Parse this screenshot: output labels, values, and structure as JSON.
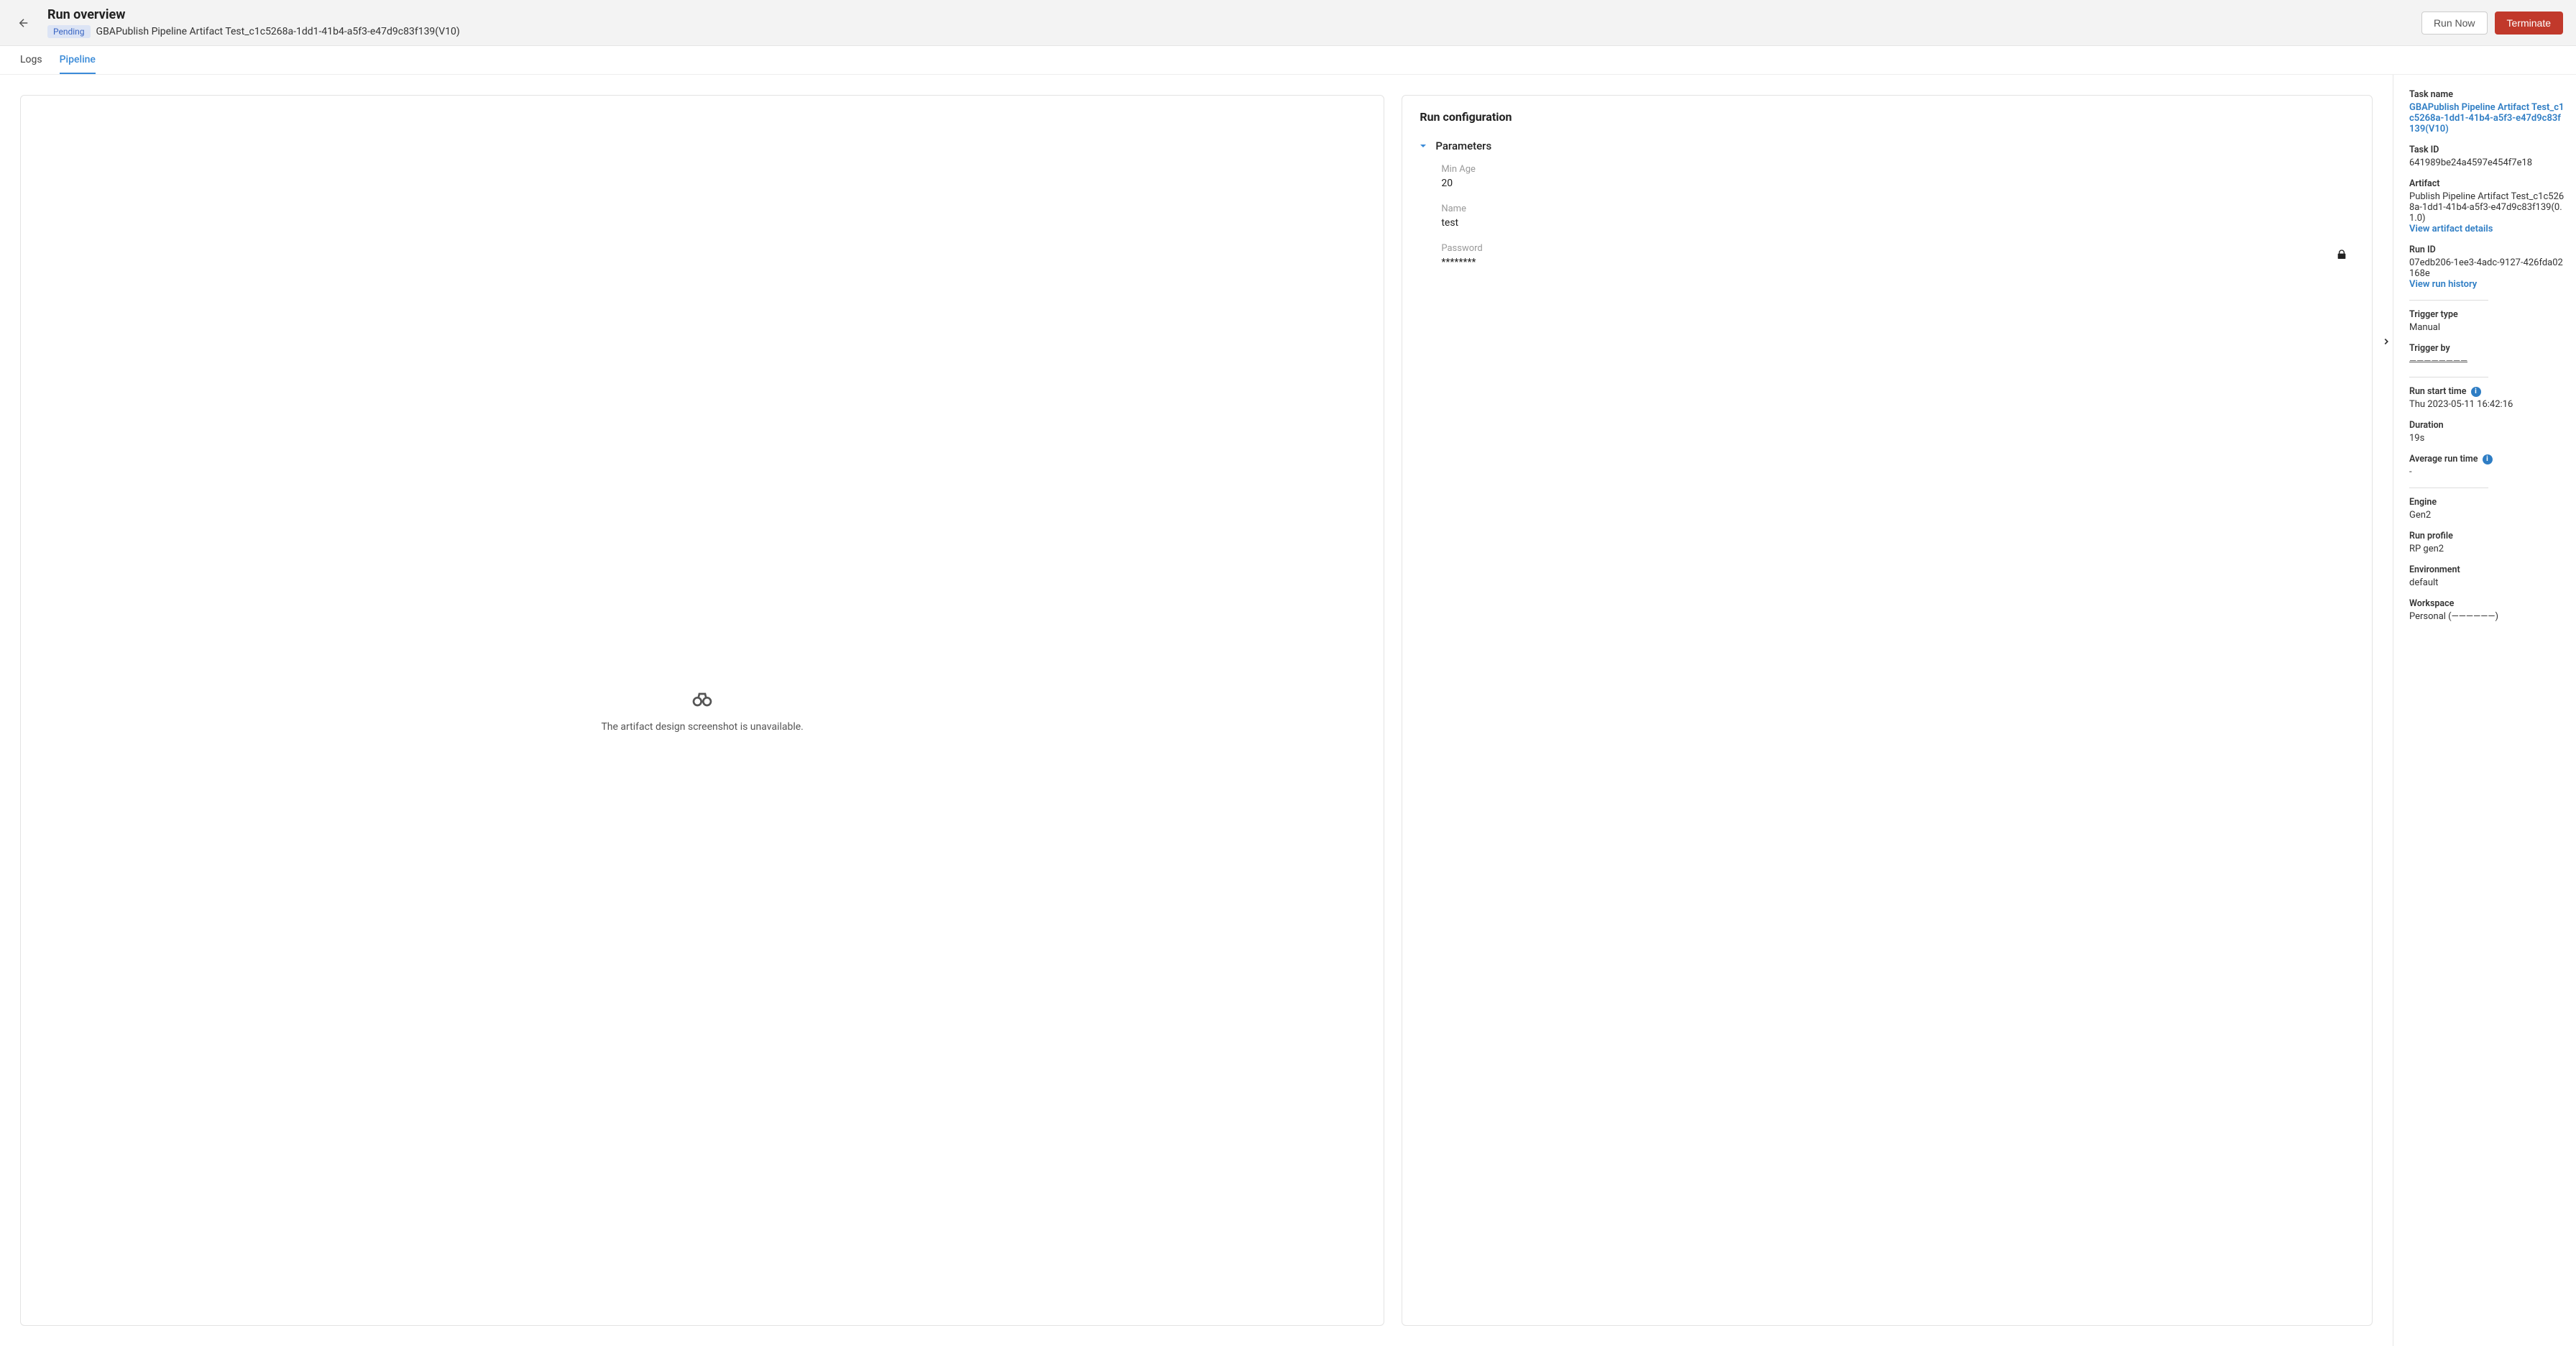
{
  "header": {
    "title": "Run overview",
    "status": "Pending",
    "run_name": "GBAPublish Pipeline Artifact Test_c1c5268a-1dd1-41b4-a5f3-e47d9c83f139(V10)",
    "actions": {
      "run_now": "Run Now",
      "terminate": "Terminate"
    }
  },
  "tabs": {
    "logs": "Logs",
    "pipeline": "Pipeline"
  },
  "main": {
    "empty_message": "The artifact design screenshot is unavailable.",
    "config_title": "Run configuration",
    "parameters_section": "Parameters",
    "params": {
      "min_age_label": "Min Age",
      "min_age_value": "20",
      "name_label": "Name",
      "name_value": "test",
      "password_label": "Password",
      "password_value": "********"
    }
  },
  "sidebar": {
    "task_name_label": "Task name",
    "task_name_value": "GBAPublish Pipeline Artifact Test_c1c5268a-1dd1-41b4-a5f3-e47d9c83f139(V10)",
    "task_id_label": "Task ID",
    "task_id_value": "641989be24a4597e454f7e18",
    "artifact_label": "Artifact",
    "artifact_value": "Publish Pipeline Artifact Test_c1c5268a-1dd1-41b4-a5f3-e47d9c83f139(0.1.0)",
    "artifact_link": "View artifact details",
    "run_id_label": "Run ID",
    "run_id_value": "07edb206-1ee3-4adc-9127-426fda02168e",
    "run_history_link": "View run history",
    "trigger_type_label": "Trigger type",
    "trigger_type_value": "Manual",
    "trigger_by_label": "Trigger by",
    "trigger_by_value": "————————",
    "run_start_label": "Run start time",
    "run_start_value": "Thu 2023-05-11 16:42:16",
    "duration_label": "Duration",
    "duration_value": "19s",
    "avg_runtime_label": "Average run time",
    "avg_runtime_value": "-",
    "engine_label": "Engine",
    "engine_value": "Gen2",
    "run_profile_label": "Run profile",
    "run_profile_value": "RP gen2",
    "environment_label": "Environment",
    "environment_value": "default",
    "workspace_label": "Workspace",
    "workspace_value": "Personal (——————)"
  }
}
